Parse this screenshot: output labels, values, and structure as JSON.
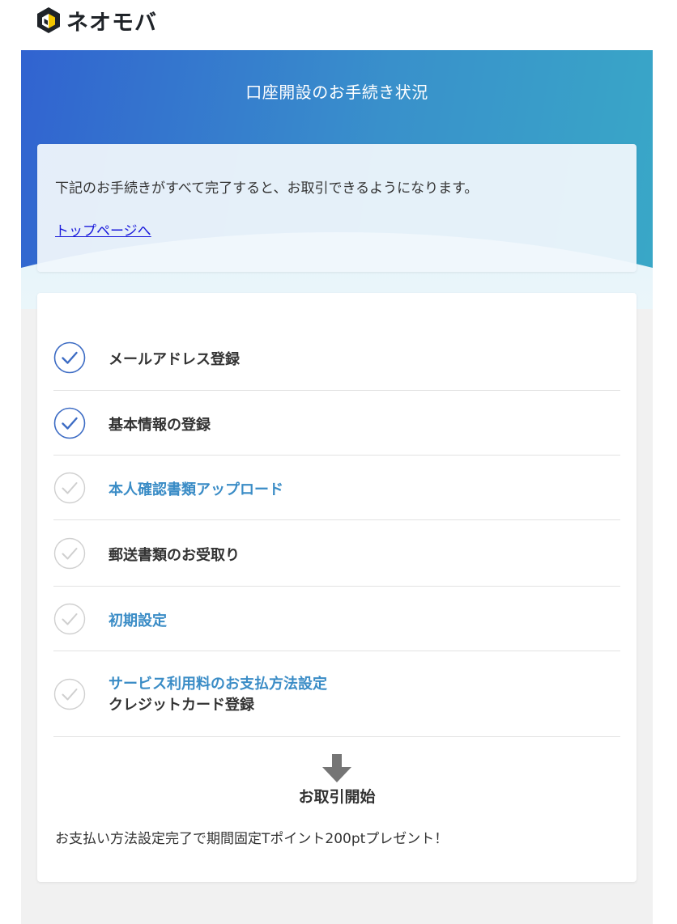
{
  "brand": {
    "name": "ネオモバ",
    "logo_icon": "neomoba-logo-icon"
  },
  "page": {
    "title": "口座開設のお手続き状況"
  },
  "notice": {
    "text": "下記のお手続きがすべて完了すると、お取引できるようになります。",
    "top_link": "トップページへ"
  },
  "steps": [
    {
      "label": "メールアドレス登録",
      "sublabel": "",
      "completed": true,
      "link": false
    },
    {
      "label": "基本情報の登録",
      "sublabel": "",
      "completed": true,
      "link": false
    },
    {
      "label": "本人確認書類アップロード",
      "sublabel": "",
      "completed": false,
      "link": true
    },
    {
      "label": "郵送書類のお受取り",
      "sublabel": "",
      "completed": false,
      "link": false
    },
    {
      "label": "初期設定",
      "sublabel": "",
      "completed": false,
      "link": true
    },
    {
      "label": "サービス利用料のお支払方法設定",
      "sublabel": "クレジットカード登録",
      "completed": false,
      "link": true
    }
  ],
  "result": {
    "label": "お取引開始",
    "arrow_icon": "arrow-down-icon"
  },
  "promo": {
    "text": "お支払い方法設定完了で期間固定Tポイント200ptプレゼント！"
  },
  "colors": {
    "accent_blue": "#3163d0",
    "link_blue": "#3a8cc6",
    "check_done": "#3d6cc4",
    "check_pending": "#d0d0d0"
  }
}
